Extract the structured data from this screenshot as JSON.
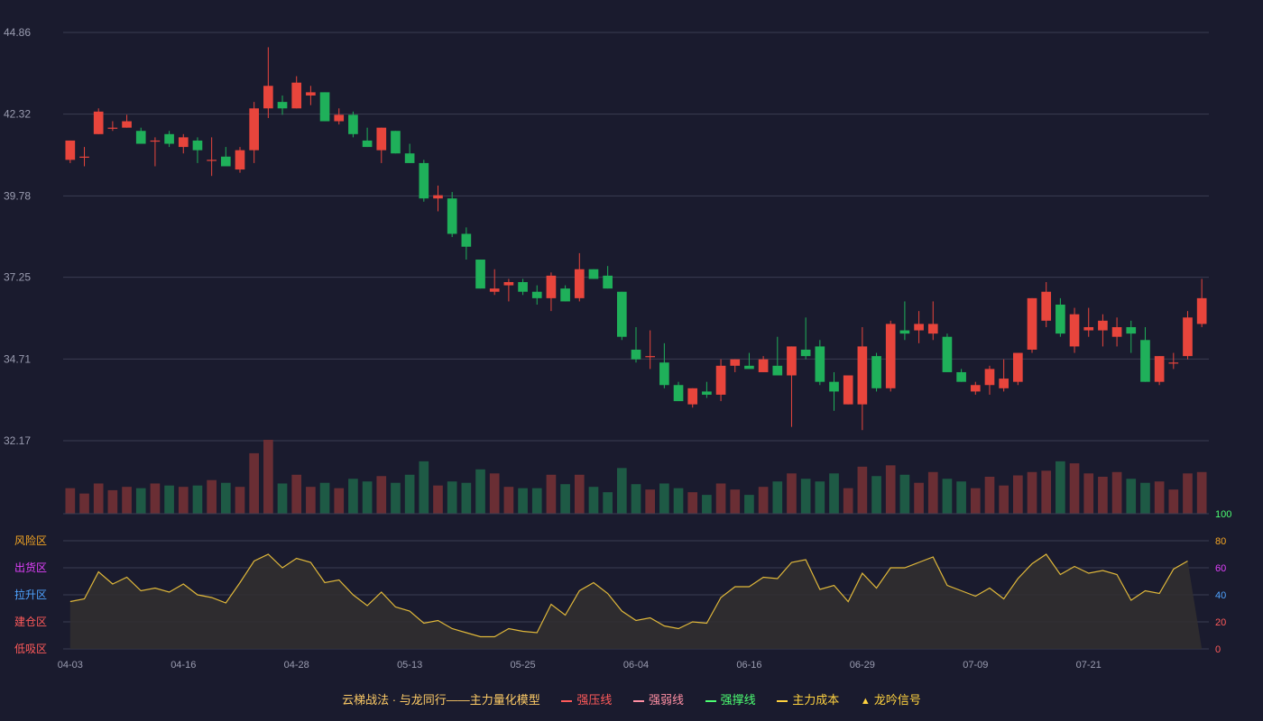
{
  "chart_data": {
    "type": "candlestick",
    "price_axis": {
      "ticks": [
        44.86,
        42.32,
        39.78,
        37.25,
        34.71,
        32.17
      ],
      "ylim": [
        32.17,
        44.86
      ]
    },
    "indicator_axis": {
      "ticks": [
        100,
        80,
        60,
        40,
        20,
        0
      ],
      "ylim": [
        0,
        100
      ]
    },
    "zones": [
      {
        "label": "风险区",
        "color": "#f5a623"
      },
      {
        "label": "出货区",
        "color": "#e040fb"
      },
      {
        "label": "拉升区",
        "color": "#4fa3ff"
      },
      {
        "label": "建仓区",
        "color": "#ff5a5a"
      },
      {
        "label": "低吸区",
        "color": "#ff5a5a"
      }
    ],
    "x_tick_labels": [
      {
        "label": "04-03",
        "index": 0
      },
      {
        "label": "04-16",
        "index": 8
      },
      {
        "label": "04-28",
        "index": 16
      },
      {
        "label": "05-13",
        "index": 24
      },
      {
        "label": "05-25",
        "index": 32
      },
      {
        "label": "06-04",
        "index": 40
      },
      {
        "label": "06-16",
        "index": 48
      },
      {
        "label": "06-29",
        "index": 56
      },
      {
        "label": "07-09",
        "index": 64
      },
      {
        "label": "07-21",
        "index": 72
      }
    ],
    "ohlc": [
      [
        40.9,
        41.5,
        40.8,
        41.5
      ],
      [
        41.0,
        41.3,
        40.7,
        41.0
      ],
      [
        41.7,
        42.5,
        41.7,
        42.4
      ],
      [
        41.9,
        42.1,
        41.8,
        41.9
      ],
      [
        41.9,
        42.3,
        41.9,
        42.1
      ],
      [
        41.8,
        41.9,
        41.4,
        41.4
      ],
      [
        41.5,
        41.6,
        40.7,
        41.5
      ],
      [
        41.7,
        41.8,
        41.3,
        41.4
      ],
      [
        41.3,
        41.7,
        41.1,
        41.6
      ],
      [
        41.5,
        41.6,
        40.8,
        41.2
      ],
      [
        40.9,
        41.6,
        40.4,
        40.9
      ],
      [
        41.0,
        41.3,
        40.7,
        40.7
      ],
      [
        40.6,
        41.3,
        40.5,
        41.2
      ],
      [
        41.2,
        42.7,
        40.8,
        42.5
      ],
      [
        42.5,
        44.4,
        42.2,
        43.2
      ],
      [
        42.7,
        42.9,
        42.3,
        42.5
      ],
      [
        42.5,
        43.5,
        42.5,
        43.3
      ],
      [
        42.9,
        43.2,
        42.6,
        43.0
      ],
      [
        43.0,
        43.0,
        42.1,
        42.1
      ],
      [
        42.1,
        42.5,
        42.0,
        42.3
      ],
      [
        42.3,
        42.4,
        41.6,
        41.7
      ],
      [
        41.5,
        41.9,
        41.3,
        41.3
      ],
      [
        41.2,
        41.9,
        40.8,
        41.9
      ],
      [
        41.8,
        41.8,
        41.1,
        41.1
      ],
      [
        41.1,
        41.4,
        40.8,
        40.8
      ],
      [
        40.8,
        40.9,
        39.6,
        39.7
      ],
      [
        39.7,
        40.1,
        39.3,
        39.8
      ],
      [
        39.7,
        39.9,
        38.5,
        38.6
      ],
      [
        38.6,
        38.8,
        37.8,
        38.2
      ],
      [
        37.8,
        37.8,
        36.9,
        36.9
      ],
      [
        36.8,
        37.5,
        36.7,
        36.9
      ],
      [
        37.0,
        37.2,
        36.5,
        37.1
      ],
      [
        37.1,
        37.2,
        36.7,
        36.8
      ],
      [
        36.8,
        37.0,
        36.4,
        36.6
      ],
      [
        36.6,
        37.4,
        36.2,
        37.3
      ],
      [
        36.9,
        37.0,
        36.5,
        36.5
      ],
      [
        36.6,
        38.0,
        36.5,
        37.5
      ],
      [
        37.5,
        37.5,
        37.2,
        37.2
      ],
      [
        37.3,
        37.6,
        36.9,
        36.9
      ],
      [
        36.8,
        36.8,
        35.3,
        35.4
      ],
      [
        35.0,
        35.7,
        34.6,
        34.7
      ],
      [
        34.8,
        35.6,
        34.4,
        34.8
      ],
      [
        34.6,
        35.2,
        33.8,
        33.9
      ],
      [
        33.9,
        34.0,
        33.5,
        33.4
      ],
      [
        33.3,
        33.8,
        33.2,
        33.8
      ],
      [
        33.7,
        34.0,
        33.5,
        33.6
      ],
      [
        33.6,
        34.7,
        33.4,
        34.5
      ],
      [
        34.5,
        34.7,
        34.3,
        34.7
      ],
      [
        34.5,
        34.9,
        34.5,
        34.4
      ],
      [
        34.3,
        34.8,
        34.3,
        34.7
      ],
      [
        34.5,
        35.4,
        34.5,
        34.2
      ],
      [
        34.2,
        35.1,
        32.6,
        35.1
      ],
      [
        35.0,
        36.0,
        34.7,
        34.8
      ],
      [
        35.1,
        35.3,
        33.9,
        34.0
      ],
      [
        34.0,
        34.3,
        33.1,
        33.7
      ],
      [
        33.3,
        34.1,
        33.3,
        34.2
      ],
      [
        33.3,
        35.7,
        32.5,
        35.1
      ],
      [
        34.8,
        34.9,
        33.7,
        33.8
      ],
      [
        33.8,
        35.9,
        33.7,
        35.8
      ],
      [
        35.6,
        36.5,
        35.3,
        35.5
      ],
      [
        35.6,
        36.2,
        35.2,
        35.8
      ],
      [
        35.5,
        36.5,
        35.3,
        35.8
      ],
      [
        35.4,
        35.5,
        34.3,
        34.3
      ],
      [
        34.3,
        34.4,
        34.0,
        34.0
      ],
      [
        33.7,
        34.0,
        33.6,
        33.9
      ],
      [
        33.9,
        34.5,
        33.6,
        34.4
      ],
      [
        33.8,
        34.7,
        33.7,
        34.1
      ],
      [
        34.0,
        34.8,
        33.9,
        34.9
      ],
      [
        35.0,
        36.6,
        34.9,
        36.6
      ],
      [
        35.9,
        37.1,
        35.7,
        36.8
      ],
      [
        36.4,
        36.6,
        35.4,
        35.5
      ],
      [
        35.1,
        36.3,
        34.9,
        36.1
      ],
      [
        35.6,
        36.3,
        35.4,
        35.7
      ],
      [
        35.6,
        36.1,
        35.1,
        35.9
      ],
      [
        35.4,
        36.0,
        35.1,
        35.7
      ],
      [
        35.7,
        35.9,
        34.9,
        35.5
      ],
      [
        35.3,
        35.7,
        34.0,
        34.0
      ],
      [
        34.0,
        34.8,
        33.9,
        34.8
      ],
      [
        34.6,
        34.9,
        34.4,
        34.6
      ],
      [
        34.8,
        36.2,
        34.7,
        36.0
      ],
      [
        35.8,
        37.2,
        35.7,
        36.6
      ]
    ],
    "volume": [
      38,
      30,
      45,
      35,
      40,
      38,
      45,
      42,
      40,
      42,
      50,
      46,
      40,
      90,
      110,
      45,
      58,
      40,
      46,
      38,
      52,
      48,
      56,
      46,
      58,
      78,
      42,
      48,
      46,
      66,
      60,
      40,
      38,
      38,
      58,
      44,
      58,
      40,
      32,
      68,
      44,
      36,
      45,
      38,
      32,
      28,
      45,
      36,
      28,
      40,
      48,
      60,
      52,
      48,
      60,
      38,
      70,
      56,
      72,
      58,
      46,
      62,
      52,
      48,
      38,
      55,
      42,
      57,
      62,
      64,
      78,
      75,
      60,
      55,
      62,
      52,
      46,
      48,
      36,
      60,
      62
    ],
    "indicator": [
      35,
      37,
      57,
      48,
      53,
      43,
      45,
      42,
      48,
      40,
      38,
      34,
      49,
      65,
      70,
      60,
      67,
      64,
      49,
      51,
      40,
      32,
      42,
      31,
      28,
      19,
      21,
      15,
      12,
      9,
      9,
      15,
      13,
      12,
      33,
      25,
      43,
      49,
      41,
      28,
      21,
      23,
      17,
      15,
      20,
      19,
      38,
      46,
      46,
      53,
      52,
      64,
      66,
      44,
      47,
      35,
      56,
      45,
      60,
      60,
      64,
      68,
      47,
      43,
      39,
      45,
      37,
      52,
      63,
      70,
      55,
      61,
      56,
      58,
      55,
      36,
      43,
      41,
      59,
      65
    ]
  },
  "legend": {
    "title": "云梯战法 · 与龙同行——主力量化模型",
    "items": [
      {
        "label": "强压线",
        "color": "#ff5a5a",
        "style": "solid"
      },
      {
        "label": "强弱线",
        "color": "#ff8fa3",
        "style": "dashed"
      },
      {
        "label": "强撑线",
        "color": "#4cff72",
        "style": "solid"
      },
      {
        "label": "主力成本",
        "color": "#ffd23f",
        "style": "dashed"
      },
      {
        "label": "龙吟信号",
        "color": "#ffd23f",
        "style": "triangle"
      }
    ]
  },
  "colors": {
    "up": "#e8453c",
    "down": "#1fb05a",
    "vol_up": "#6a2e34",
    "vol_down": "#1e5a45",
    "grid": "#3a3c52",
    "axis_text": "#9a9cb0",
    "indicator_line": "#e0b83a",
    "indicator_fill": "#332f2f"
  }
}
